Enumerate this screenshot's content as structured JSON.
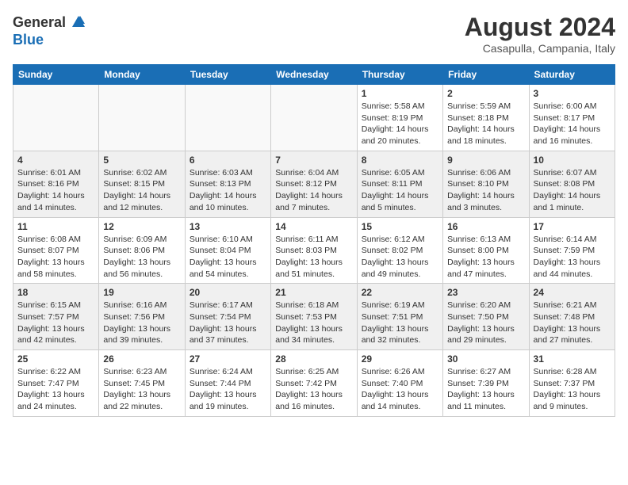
{
  "header": {
    "logo_general": "General",
    "logo_blue": "Blue",
    "month": "August 2024",
    "location": "Casapulla, Campania, Italy"
  },
  "weekdays": [
    "Sunday",
    "Monday",
    "Tuesday",
    "Wednesday",
    "Thursday",
    "Friday",
    "Saturday"
  ],
  "weeks": [
    [
      {
        "day": "",
        "info": ""
      },
      {
        "day": "",
        "info": ""
      },
      {
        "day": "",
        "info": ""
      },
      {
        "day": "",
        "info": ""
      },
      {
        "day": "1",
        "info": "Sunrise: 5:58 AM\nSunset: 8:19 PM\nDaylight: 14 hours\nand 20 minutes."
      },
      {
        "day": "2",
        "info": "Sunrise: 5:59 AM\nSunset: 8:18 PM\nDaylight: 14 hours\nand 18 minutes."
      },
      {
        "day": "3",
        "info": "Sunrise: 6:00 AM\nSunset: 8:17 PM\nDaylight: 14 hours\nand 16 minutes."
      }
    ],
    [
      {
        "day": "4",
        "info": "Sunrise: 6:01 AM\nSunset: 8:16 PM\nDaylight: 14 hours\nand 14 minutes."
      },
      {
        "day": "5",
        "info": "Sunrise: 6:02 AM\nSunset: 8:15 PM\nDaylight: 14 hours\nand 12 minutes."
      },
      {
        "day": "6",
        "info": "Sunrise: 6:03 AM\nSunset: 8:13 PM\nDaylight: 14 hours\nand 10 minutes."
      },
      {
        "day": "7",
        "info": "Sunrise: 6:04 AM\nSunset: 8:12 PM\nDaylight: 14 hours\nand 7 minutes."
      },
      {
        "day": "8",
        "info": "Sunrise: 6:05 AM\nSunset: 8:11 PM\nDaylight: 14 hours\nand 5 minutes."
      },
      {
        "day": "9",
        "info": "Sunrise: 6:06 AM\nSunset: 8:10 PM\nDaylight: 14 hours\nand 3 minutes."
      },
      {
        "day": "10",
        "info": "Sunrise: 6:07 AM\nSunset: 8:08 PM\nDaylight: 14 hours\nand 1 minute."
      }
    ],
    [
      {
        "day": "11",
        "info": "Sunrise: 6:08 AM\nSunset: 8:07 PM\nDaylight: 13 hours\nand 58 minutes."
      },
      {
        "day": "12",
        "info": "Sunrise: 6:09 AM\nSunset: 8:06 PM\nDaylight: 13 hours\nand 56 minutes."
      },
      {
        "day": "13",
        "info": "Sunrise: 6:10 AM\nSunset: 8:04 PM\nDaylight: 13 hours\nand 54 minutes."
      },
      {
        "day": "14",
        "info": "Sunrise: 6:11 AM\nSunset: 8:03 PM\nDaylight: 13 hours\nand 51 minutes."
      },
      {
        "day": "15",
        "info": "Sunrise: 6:12 AM\nSunset: 8:02 PM\nDaylight: 13 hours\nand 49 minutes."
      },
      {
        "day": "16",
        "info": "Sunrise: 6:13 AM\nSunset: 8:00 PM\nDaylight: 13 hours\nand 47 minutes."
      },
      {
        "day": "17",
        "info": "Sunrise: 6:14 AM\nSunset: 7:59 PM\nDaylight: 13 hours\nand 44 minutes."
      }
    ],
    [
      {
        "day": "18",
        "info": "Sunrise: 6:15 AM\nSunset: 7:57 PM\nDaylight: 13 hours\nand 42 minutes."
      },
      {
        "day": "19",
        "info": "Sunrise: 6:16 AM\nSunset: 7:56 PM\nDaylight: 13 hours\nand 39 minutes."
      },
      {
        "day": "20",
        "info": "Sunrise: 6:17 AM\nSunset: 7:54 PM\nDaylight: 13 hours\nand 37 minutes."
      },
      {
        "day": "21",
        "info": "Sunrise: 6:18 AM\nSunset: 7:53 PM\nDaylight: 13 hours\nand 34 minutes."
      },
      {
        "day": "22",
        "info": "Sunrise: 6:19 AM\nSunset: 7:51 PM\nDaylight: 13 hours\nand 32 minutes."
      },
      {
        "day": "23",
        "info": "Sunrise: 6:20 AM\nSunset: 7:50 PM\nDaylight: 13 hours\nand 29 minutes."
      },
      {
        "day": "24",
        "info": "Sunrise: 6:21 AM\nSunset: 7:48 PM\nDaylight: 13 hours\nand 27 minutes."
      }
    ],
    [
      {
        "day": "25",
        "info": "Sunrise: 6:22 AM\nSunset: 7:47 PM\nDaylight: 13 hours\nand 24 minutes."
      },
      {
        "day": "26",
        "info": "Sunrise: 6:23 AM\nSunset: 7:45 PM\nDaylight: 13 hours\nand 22 minutes."
      },
      {
        "day": "27",
        "info": "Sunrise: 6:24 AM\nSunset: 7:44 PM\nDaylight: 13 hours\nand 19 minutes."
      },
      {
        "day": "28",
        "info": "Sunrise: 6:25 AM\nSunset: 7:42 PM\nDaylight: 13 hours\nand 16 minutes."
      },
      {
        "day": "29",
        "info": "Sunrise: 6:26 AM\nSunset: 7:40 PM\nDaylight: 13 hours\nand 14 minutes."
      },
      {
        "day": "30",
        "info": "Sunrise: 6:27 AM\nSunset: 7:39 PM\nDaylight: 13 hours\nand 11 minutes."
      },
      {
        "day": "31",
        "info": "Sunrise: 6:28 AM\nSunset: 7:37 PM\nDaylight: 13 hours\nand 9 minutes."
      }
    ]
  ]
}
